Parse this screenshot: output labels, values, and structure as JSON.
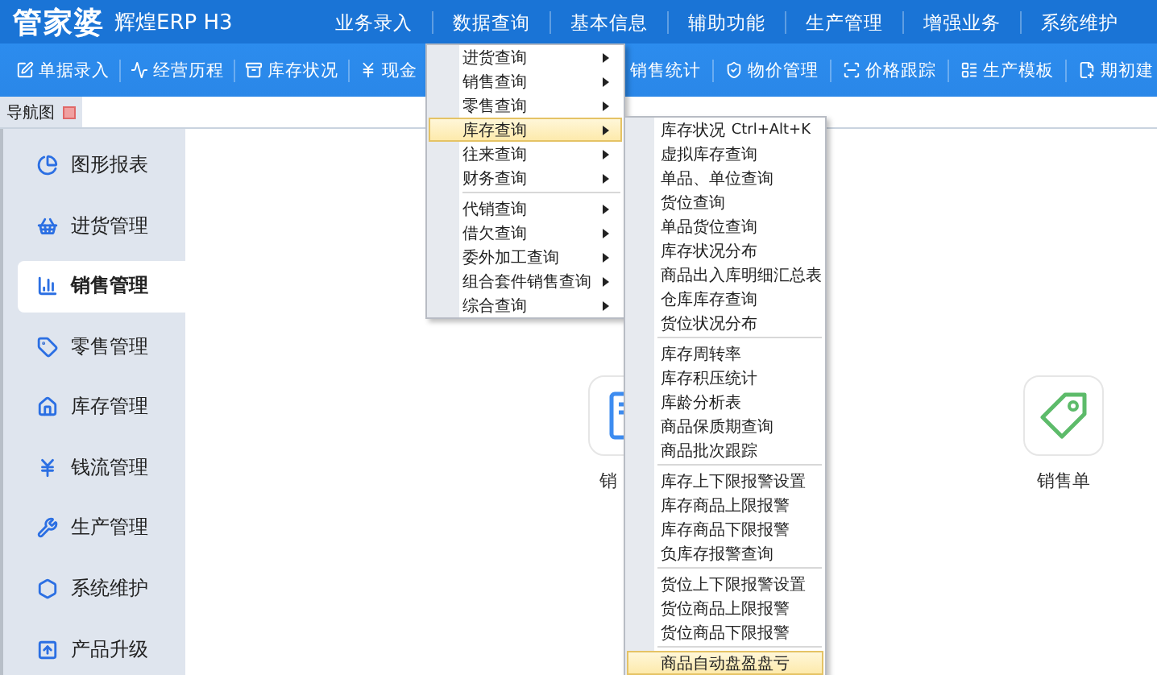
{
  "header": {
    "brand": "管家婆",
    "product": "辉煌ERP H3",
    "menu": [
      "业务录入",
      "数据查询",
      "基本信息",
      "辅助功能",
      "生产管理",
      "增强业务",
      "系统维护"
    ]
  },
  "toolbar": {
    "left": [
      "单据录入",
      "经营历程",
      "库存状况",
      "现金"
    ],
    "right": [
      "销售统计",
      "物价管理",
      "价格跟踪",
      "生产模板",
      "期初建"
    ]
  },
  "tabs": [
    {
      "label": "导航图",
      "selected": true
    }
  ],
  "sidebar": {
    "items": [
      {
        "label": "图形报表",
        "selected": false
      },
      {
        "label": "进货管理",
        "selected": false
      },
      {
        "label": "销售管理",
        "selected": true
      },
      {
        "label": "零售管理",
        "selected": false
      },
      {
        "label": "库存管理",
        "selected": false
      },
      {
        "label": "钱流管理",
        "selected": false
      },
      {
        "label": "生产管理",
        "selected": false
      },
      {
        "label": "系统维护",
        "selected": false
      },
      {
        "label": "产品升级",
        "selected": false
      }
    ]
  },
  "content": {
    "tiles": [
      {
        "kind": "document",
        "label": "销"
      },
      {
        "kind": "tag",
        "label": "销售单"
      }
    ]
  },
  "menu": {
    "groups": [
      [
        {
          "label": "进货查询",
          "selected": false
        },
        {
          "label": "销售查询",
          "selected": false
        },
        {
          "label": "零售查询",
          "selected": false
        },
        {
          "label": "库存查询",
          "selected": true
        },
        {
          "label": "往来查询",
          "selected": false
        },
        {
          "label": "财务查询",
          "selected": false
        }
      ],
      [
        {
          "label": "代销查询",
          "selected": false
        },
        {
          "label": "借欠查询",
          "selected": false
        },
        {
          "label": "委外加工查询",
          "selected": false
        },
        {
          "label": "组合套件销售查询",
          "selected": false
        },
        {
          "label": "综合查询",
          "selected": false
        }
      ]
    ]
  },
  "submenu": {
    "groups": [
      [
        {
          "label": "库存状况",
          "shortcut": "Ctrl+Alt+K",
          "selected": false
        },
        {
          "label": "虚拟库存查询",
          "selected": false
        },
        {
          "label": "单品、单位查询",
          "selected": false
        },
        {
          "label": "货位查询",
          "selected": false
        },
        {
          "label": "单品货位查询",
          "selected": false
        },
        {
          "label": "库存状况分布",
          "selected": false
        },
        {
          "label": "商品出入库明细汇总表",
          "selected": false
        },
        {
          "label": "仓库库存查询",
          "selected": false
        },
        {
          "label": "货位状况分布",
          "selected": false
        }
      ],
      [
        {
          "label": "库存周转率",
          "selected": false
        },
        {
          "label": "库存积压统计",
          "selected": false
        },
        {
          "label": "库龄分析表",
          "selected": false
        },
        {
          "label": "商品保质期查询",
          "selected": false
        },
        {
          "label": "商品批次跟踪",
          "selected": false
        }
      ],
      [
        {
          "label": "库存上下限报警设置",
          "selected": false
        },
        {
          "label": "库存商品上限报警",
          "selected": false
        },
        {
          "label": "库存商品下限报警",
          "selected": false
        },
        {
          "label": "负库存报警查询",
          "selected": false
        }
      ],
      [
        {
          "label": "货位上下限报警设置",
          "selected": false
        },
        {
          "label": "货位商品上限报警",
          "selected": false
        },
        {
          "label": "货位商品下限报警",
          "selected": false
        }
      ],
      [
        {
          "label": "商品自动盘盈盘亏",
          "selected": true
        }
      ]
    ]
  }
}
